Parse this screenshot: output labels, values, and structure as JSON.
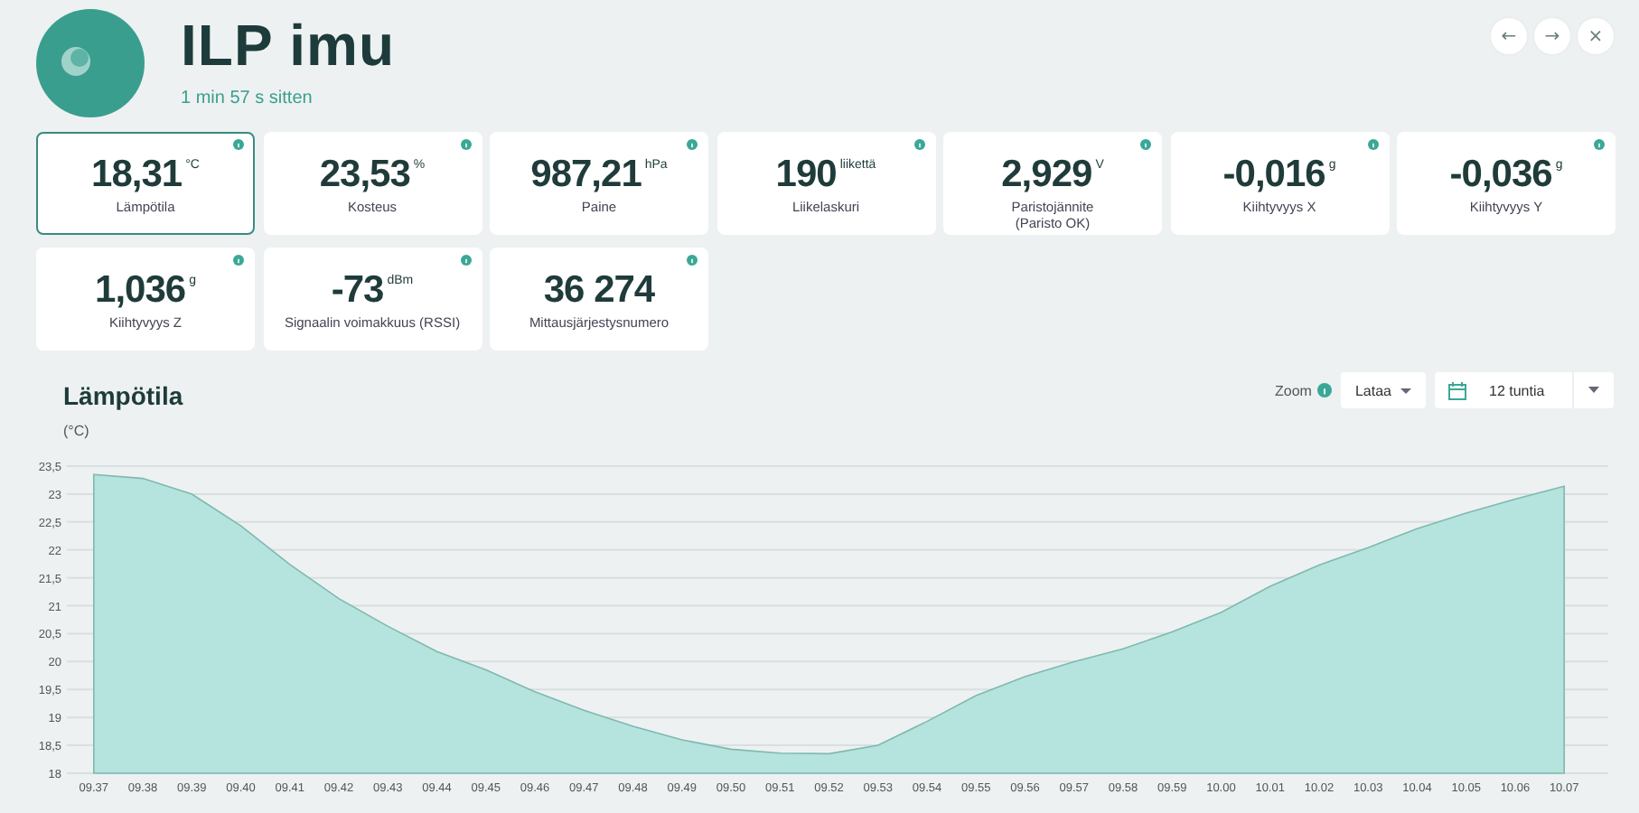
{
  "header": {
    "title": "ILP imu",
    "subtitle": "1 min 57 s sitten",
    "nav_buttons": [
      "←",
      "→",
      "×"
    ]
  },
  "cards": [
    {
      "value": "18,31",
      "unit": "°C",
      "label": "Lämpötila",
      "selected": true
    },
    {
      "value": "23,53",
      "unit": "%",
      "label": "Kosteus",
      "selected": false
    },
    {
      "value": "987,21",
      "unit": "hPa",
      "label": "Paine",
      "selected": false
    },
    {
      "value": "190",
      "unit": "liikettä",
      "label": "Liikelaskuri",
      "selected": false
    },
    {
      "value": "2,929",
      "unit": "V",
      "label": "Paristojännite",
      "note": "(Paristo OK)",
      "selected": false
    },
    {
      "value": "-0,016",
      "unit": "g",
      "label": "Kiihtyvyys X",
      "selected": false
    },
    {
      "value": "-0,036",
      "unit": "g",
      "label": "Kiihtyvyys Y",
      "selected": false
    },
    {
      "value": "1,036",
      "unit": "g",
      "label": "Kiihtyvyys Z",
      "selected": false
    },
    {
      "value": "-73",
      "unit": "dBm",
      "label": "Signaalin voimakkuus (RSSI)",
      "selected": false
    },
    {
      "value": "36 274",
      "label": "Mittausjärjestysnumero",
      "selected": false
    }
  ],
  "chart_section": {
    "title": "Lämpötila",
    "unit": "(°C)",
    "zoom_label": "Zoom",
    "download_button": "Lataa",
    "range": "12 tuntia",
    "chart_data": {
      "type": "area",
      "grid": true,
      "ylim": [
        18,
        23.5
      ],
      "categories": [
        "09.37",
        "09.38",
        "09.39",
        "09.40",
        "09.41",
        "09.42",
        "09.43",
        "09.44",
        "09.45",
        "09.46",
        "09.47",
        "09.48",
        "09.49",
        "09.50",
        "09.51",
        "09.52",
        "09.53",
        "09.54",
        "09.55",
        "09.56",
        "09.57",
        "09.58",
        "09.59",
        "10.00",
        "10.01",
        "10.02",
        "10.03",
        "10.04",
        "10.05",
        "10.06",
        "10.07"
      ],
      "series": [
        {
          "color": "#b5e3dd",
          "values": [
            23.35,
            23.28,
            23.0,
            22.43,
            21.74,
            21.13,
            20.63,
            20.18,
            19.85,
            19.46,
            19.13,
            18.84,
            18.6,
            18.43,
            18.36,
            18.35,
            18.5,
            18.93,
            19.39,
            19.73,
            20.0,
            20.23,
            20.53,
            20.88,
            21.35,
            21.73,
            22.04,
            22.38,
            22.66,
            22.91,
            23.14
          ]
        }
      ],
      "yticks": [
        {
          "value": 18,
          "label": "18"
        },
        {
          "value": 18.5,
          "label": "18,5"
        },
        {
          "value": 19,
          "label": "19"
        },
        {
          "value": 19.5,
          "label": "19,5"
        },
        {
          "value": 20,
          "label": "20"
        },
        {
          "value": 20.5,
          "label": "20,5"
        },
        {
          "value": 21,
          "label": "21"
        },
        {
          "value": 21.5,
          "label": "21,5"
        },
        {
          "value": 22,
          "label": "22"
        },
        {
          "value": 22.5,
          "label": "22,5"
        },
        {
          "value": 23,
          "label": "23"
        },
        {
          "value": 23.5,
          "label": "23,5"
        }
      ]
    }
  }
}
